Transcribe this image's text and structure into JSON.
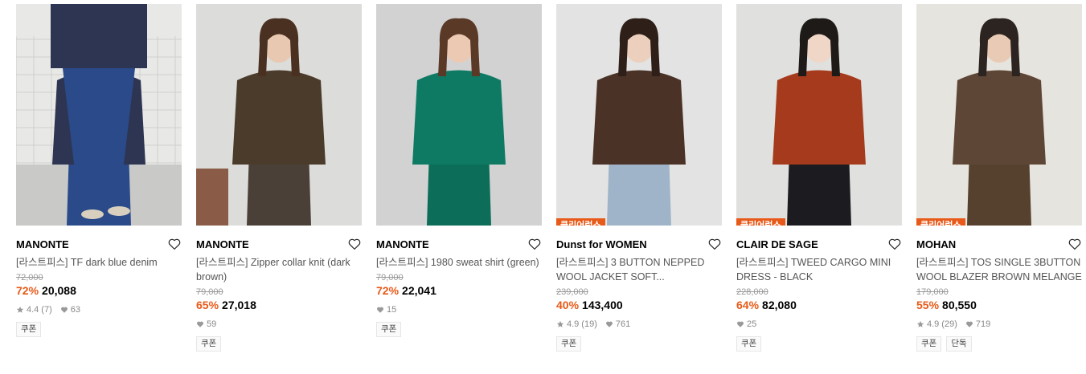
{
  "products": [
    {
      "brand": "MANONTE",
      "name": "[라스트피스] TF dark blue denim",
      "original_price": "72,000",
      "discount": "72%",
      "price": "20,088",
      "rating": "4.4",
      "reviews": "(7)",
      "likes": "63",
      "badge": "",
      "tags": [
        "쿠폰"
      ],
      "photo": {
        "bg": "#e8e8e6",
        "top": "#2d3552",
        "bottom": "#2b4a8a",
        "skin": "#e7c9b5",
        "hair": "#3b2a1f"
      }
    },
    {
      "brand": "MANONTE",
      "name": "[라스트피스] Zipper collar knit (dark brown)",
      "original_price": "79,000",
      "discount": "65%",
      "price": "27,018",
      "rating": "",
      "reviews": "",
      "likes": "59",
      "badge": "",
      "tags": [
        "쿠폰"
      ],
      "photo": {
        "bg": "#dcdcda",
        "top": "#4a3b2a",
        "bottom": "#4a4038",
        "skin": "#e8c8b0",
        "hair": "#4a3020"
      }
    },
    {
      "brand": "MANONTE",
      "name": "[라스트피스] 1980 sweat shirt (green)",
      "original_price": "79,000",
      "discount": "72%",
      "price": "22,041",
      "rating": "",
      "reviews": "",
      "likes": "15",
      "badge": "",
      "tags": [
        "쿠폰"
      ],
      "photo": {
        "bg": "#d2d2d2",
        "top": "#0e7a63",
        "bottom": "#0c6e58",
        "skin": "#ecc9b2",
        "hair": "#5a3a26"
      }
    },
    {
      "brand": "Dunst for WOMEN",
      "name": "[라스트피스] 3 BUTTON NEPPED WOOL JACKET SOFT...",
      "original_price": "239,000",
      "discount": "40%",
      "price": "143,400",
      "rating": "4.9",
      "reviews": "(19)",
      "likes": "761",
      "badge": "클리어런스",
      "tags": [
        "쿠폰"
      ],
      "photo": {
        "bg": "#e3e3e3",
        "top": "#4a3226",
        "bottom": "#9fb4c8",
        "skin": "#ecd0bd",
        "hair": "#2e2018"
      }
    },
    {
      "brand": "CLAIR DE SAGE",
      "name": "[라스트피스] TWEED CARGO MINI DRESS - BLACK",
      "original_price": "228,000",
      "discount": "64%",
      "price": "82,080",
      "rating": "",
      "reviews": "",
      "likes": "25",
      "badge": "클리어런스",
      "tags": [
        "쿠폰"
      ],
      "photo": {
        "bg": "#e0e0de",
        "top": "#a53b1c",
        "bottom": "#1c1c20",
        "skin": "#f0d6c6",
        "hair": "#1e1a18"
      }
    },
    {
      "brand": "MOHAN",
      "name": "[라스트피스] TOS SINGLE 3BUTTON WOOL BLAZER BROWN MELANGE",
      "original_price": "179,000",
      "discount": "55%",
      "price": "80,550",
      "rating": "4.9",
      "reviews": "(29)",
      "likes": "719",
      "badge": "클리어런스",
      "tags": [
        "쿠폰",
        "단독"
      ],
      "photo": {
        "bg": "#e6e4df",
        "top": "#5e4636",
        "bottom": "#56412f",
        "skin": "#e9cbb5",
        "hair": "#2c2420"
      }
    }
  ],
  "colors": {
    "accent": "#e85a19",
    "muted": "#888888"
  },
  "icons": {
    "like": "heart-outline-icon",
    "rating": "star-icon",
    "likes": "heart-filled-icon"
  }
}
